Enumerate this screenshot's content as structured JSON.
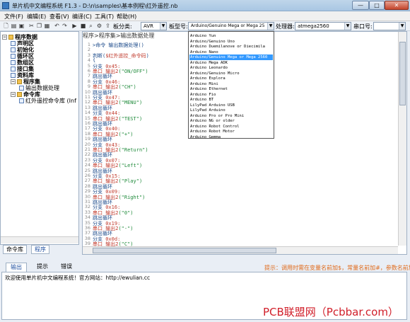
{
  "window": {
    "title": "单片机中文编程系统 F1.3 - D:\\n\\samples\\基本例程\\红外遥控.nb",
    "min": "—",
    "max": "□",
    "close": "✕"
  },
  "menu": [
    "文件(F)",
    "编辑(E)",
    "查看(V)",
    "编译(C)",
    "工具(T)",
    "帮助(H)"
  ],
  "toolbar": {
    "board_category_label": "板分类:",
    "board_category_value": "AVR",
    "board_model_label": "板型号:",
    "board_model_value": "Arduino/Genuino Mega or Mega 25",
    "processor_label": "处理器:",
    "processor_value": "atmega2560",
    "port_label": "串口号:",
    "port_value": ""
  },
  "tree": {
    "root": "程序数据",
    "items": [
      "声明区",
      "初始化",
      "循环区",
      "数组区",
      "接口集",
      "资料库"
    ],
    "program_set": "程序集",
    "program_item": "输出数据处理",
    "command_lib": "命令库",
    "command_item": "红外遥控命令库 (Inf"
  },
  "left_tabs": [
    "命令库",
    "程序"
  ],
  "breadcrumb": "程序>程序集>输出数据处理",
  "code_lines": [
    {
      "n": "1",
      "parts": [
        {
          "t": ">命令   输出数据处理()",
          "c": "c-dark"
        }
      ]
    },
    {
      "n": "2",
      "parts": [
        {
          "t": "",
          "c": "c-dark"
        }
      ]
    },
    {
      "n": "3",
      "parts": [
        {
          "t": "判断(",
          "c": "c-dark"
        },
        {
          "t": "$红外遥控_命令码",
          "c": "c-red"
        },
        {
          "t": ")",
          "c": "c-dark"
        }
      ]
    },
    {
      "n": "4",
      "parts": [
        {
          "t": "{",
          "c": "c-dark"
        }
      ]
    },
    {
      "n": "5",
      "parts": [
        {
          "t": "  分支 ",
          "c": "c-dark"
        },
        {
          "t": "0x45:",
          "c": "c-red"
        }
      ]
    },
    {
      "n": "6",
      "parts": [
        {
          "t": "      ",
          "c": "c-dark"
        },
        {
          "t": "串口_输出2",
          "c": "c-red"
        },
        {
          "t": "(\"ON/OFF\")",
          "c": "c-green"
        }
      ]
    },
    {
      "n": "7",
      "parts": [
        {
          "t": "      跳出循环",
          "c": "c-dark"
        }
      ]
    },
    {
      "n": "8",
      "parts": [
        {
          "t": "  分支 ",
          "c": "c-dark"
        },
        {
          "t": "0x46:",
          "c": "c-red"
        }
      ]
    },
    {
      "n": "9",
      "parts": [
        {
          "t": "      ",
          "c": "c-dark"
        },
        {
          "t": "串口_输出2",
          "c": "c-red"
        },
        {
          "t": "(\"CH\")",
          "c": "c-green"
        }
      ]
    },
    {
      "n": "10",
      "parts": [
        {
          "t": "      跳出循环",
          "c": "c-dark"
        }
      ]
    },
    {
      "n": "11",
      "parts": [
        {
          "t": "  分支 ",
          "c": "c-dark"
        },
        {
          "t": "0x47:",
          "c": "c-red"
        }
      ]
    },
    {
      "n": "12",
      "parts": [
        {
          "t": "      ",
          "c": "c-dark"
        },
        {
          "t": "串口_输出2",
          "c": "c-red"
        },
        {
          "t": "(\"MENU\")",
          "c": "c-green"
        }
      ]
    },
    {
      "n": "13",
      "parts": [
        {
          "t": "      跳出循环",
          "c": "c-dark"
        }
      ]
    },
    {
      "n": "14",
      "parts": [
        {
          "t": "  分支 ",
          "c": "c-dark"
        },
        {
          "t": "0x44:",
          "c": "c-red"
        }
      ]
    },
    {
      "n": "15",
      "parts": [
        {
          "t": "      ",
          "c": "c-dark"
        },
        {
          "t": "串口_输出2",
          "c": "c-red"
        },
        {
          "t": "(\"TEST\")",
          "c": "c-green"
        }
      ]
    },
    {
      "n": "16",
      "parts": [
        {
          "t": "      跳出循环",
          "c": "c-dark"
        }
      ]
    },
    {
      "n": "17",
      "parts": [
        {
          "t": "  分支 ",
          "c": "c-dark"
        },
        {
          "t": "0x40:",
          "c": "c-red"
        }
      ]
    },
    {
      "n": "18",
      "parts": [
        {
          "t": "      ",
          "c": "c-dark"
        },
        {
          "t": "串口_输出2",
          "c": "c-red"
        },
        {
          "t": "(\"+\")",
          "c": "c-green"
        }
      ]
    },
    {
      "n": "19",
      "parts": [
        {
          "t": "      跳出循环",
          "c": "c-dark"
        }
      ]
    },
    {
      "n": "20",
      "parts": [
        {
          "t": "  分支 ",
          "c": "c-dark"
        },
        {
          "t": "0x43:",
          "c": "c-red"
        }
      ]
    },
    {
      "n": "21",
      "parts": [
        {
          "t": "      ",
          "c": "c-dark"
        },
        {
          "t": "串口_输出2",
          "c": "c-red"
        },
        {
          "t": "(\"Return\")",
          "c": "c-green"
        }
      ]
    },
    {
      "n": "22",
      "parts": [
        {
          "t": "      跳出循环",
          "c": "c-dark"
        }
      ]
    },
    {
      "n": "23",
      "parts": [
        {
          "t": "  分支 ",
          "c": "c-dark"
        },
        {
          "t": "0x07:",
          "c": "c-red"
        }
      ]
    },
    {
      "n": "24",
      "parts": [
        {
          "t": "      ",
          "c": "c-dark"
        },
        {
          "t": "串口_输出2",
          "c": "c-red"
        },
        {
          "t": "(\"Left\")",
          "c": "c-green"
        }
      ]
    },
    {
      "n": "25",
      "parts": [
        {
          "t": "      跳出循环",
          "c": "c-dark"
        }
      ]
    },
    {
      "n": "26",
      "parts": [
        {
          "t": "  分支 ",
          "c": "c-dark"
        },
        {
          "t": "0x15:",
          "c": "c-red"
        }
      ]
    },
    {
      "n": "27",
      "parts": [
        {
          "t": "      ",
          "c": "c-dark"
        },
        {
          "t": "串口_输出2",
          "c": "c-red"
        },
        {
          "t": "(\"Play\")",
          "c": "c-green"
        }
      ]
    },
    {
      "n": "28",
      "parts": [
        {
          "t": "      跳出循环",
          "c": "c-dark"
        }
      ]
    },
    {
      "n": "29",
      "parts": [
        {
          "t": "  分支 ",
          "c": "c-dark"
        },
        {
          "t": "0x09:",
          "c": "c-red"
        }
      ]
    },
    {
      "n": "30",
      "parts": [
        {
          "t": "      ",
          "c": "c-dark"
        },
        {
          "t": "串口_输出2",
          "c": "c-red"
        },
        {
          "t": "(\"Right\")",
          "c": "c-green"
        }
      ]
    },
    {
      "n": "31",
      "parts": [
        {
          "t": "      跳出循环",
          "c": "c-dark"
        }
      ]
    },
    {
      "n": "32",
      "parts": [
        {
          "t": "  分支 ",
          "c": "c-dark"
        },
        {
          "t": "0x16:",
          "c": "c-red"
        }
      ]
    },
    {
      "n": "33",
      "parts": [
        {
          "t": "      ",
          "c": "c-dark"
        },
        {
          "t": "串口_输出2",
          "c": "c-red"
        },
        {
          "t": "(\"0\")",
          "c": "c-green"
        }
      ]
    },
    {
      "n": "34",
      "parts": [
        {
          "t": "      跳出循环",
          "c": "c-dark"
        }
      ]
    },
    {
      "n": "35",
      "parts": [
        {
          "t": "  分支 ",
          "c": "c-dark"
        },
        {
          "t": "0x19:",
          "c": "c-red"
        }
      ]
    },
    {
      "n": "36",
      "parts": [
        {
          "t": "      ",
          "c": "c-dark"
        },
        {
          "t": "串口_输出2",
          "c": "c-red"
        },
        {
          "t": "(\"-\")",
          "c": "c-green"
        }
      ]
    },
    {
      "n": "37",
      "parts": [
        {
          "t": "      跳出循环",
          "c": "c-dark"
        }
      ]
    },
    {
      "n": "38",
      "parts": [
        {
          "t": "  分支 ",
          "c": "c-dark"
        },
        {
          "t": "0x0d:",
          "c": "c-red"
        }
      ]
    },
    {
      "n": "39",
      "parts": [
        {
          "t": "      ",
          "c": "c-dark"
        },
        {
          "t": "串口_输出2",
          "c": "c-red"
        },
        {
          "t": "(\"C\")",
          "c": "c-green"
        }
      ]
    }
  ],
  "dropdown": {
    "items": [
      "Arduino Yun",
      "Arduino/Genuino Uno",
      "Arduino Duemilanove or Diecimila",
      "Arduino Nano",
      "Arduino/Genuino Mega or Mega 2560",
      "Arduino Mega ADK",
      "Arduino Leonardo",
      "Arduino/Genuino Micro",
      "Arduino Esplora",
      "Arduino Mini",
      "Arduino Ethernet",
      "Arduino Fio",
      "Arduino BT",
      "LilyPad Arduino USB",
      "LilyPad Arduino",
      "Arduino Pro or Pro Mini",
      "Arduino NG or older",
      "Arduino Robot Control",
      "Arduino Robot Motor",
      "Arduino Gemma"
    ],
    "selected_index": 4
  },
  "bottom_tabs": [
    "输出",
    "提示",
    "错误"
  ],
  "hint": "提示：调用时需在变量名前加$，常量名前加#，参数名前加@",
  "output_text": "欢迎使用单片机中文编程系统！官方网站：http://ewulian.cc",
  "watermark": "PCB联盟网（Pcbbar.com）",
  "colors": {
    "selection": "#3399ff",
    "hint": "#e06a1a",
    "watermark": "#d11f2a"
  }
}
